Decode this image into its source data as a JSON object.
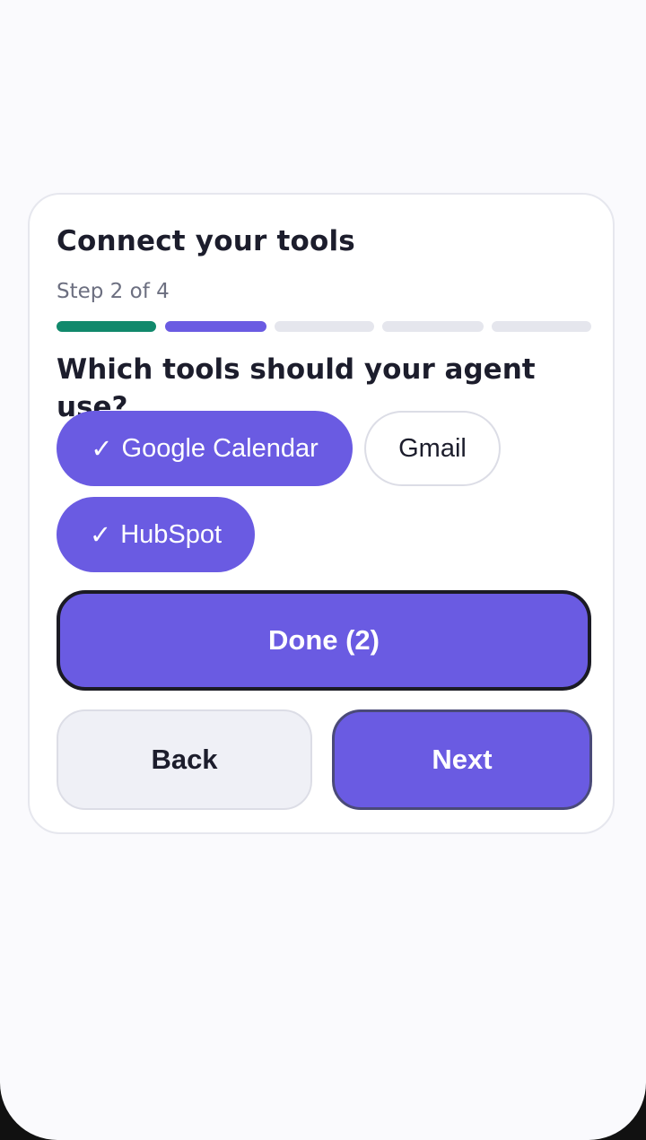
{
  "card": {
    "title": "Connect your tools",
    "step_text": "Step 2 of 4",
    "progress": {
      "segments": [
        {
          "state": "complete",
          "color": "#11896c"
        },
        {
          "state": "current",
          "color": "#6a5be2"
        },
        {
          "state": "pending",
          "color": "#e5e6ed"
        },
        {
          "state": "pending",
          "color": "#e5e6ed"
        },
        {
          "state": "pending",
          "color": "#e5e6ed"
        }
      ]
    },
    "question": "Which tools should your agent use?",
    "options": [
      {
        "label": "Google Calendar",
        "selected": true,
        "check": "✓"
      },
      {
        "label": "Gmail",
        "selected": false
      },
      {
        "label": "HubSpot",
        "selected": true,
        "check": "✓"
      }
    ],
    "done_label": "Done (2)",
    "back_label": "Back",
    "next_label": "Next"
  },
  "colors": {
    "accent": "#6a5be2",
    "success": "#11896c",
    "page_background": "#fafafd",
    "text_primary": "#1c1d2c",
    "text_secondary": "#6c6f80"
  }
}
